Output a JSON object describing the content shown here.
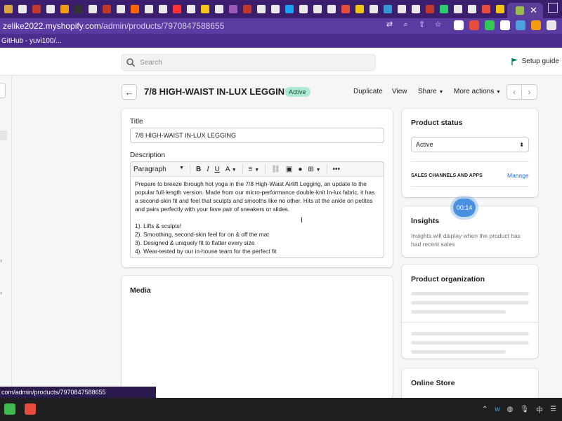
{
  "browser": {
    "tab_favicons": [
      "#d9a441",
      "#e8e8e8",
      "#c0392b",
      "#e8e8e8",
      "#f39c12",
      "#333",
      "#e8e8e8",
      "#c0392b",
      "#e8e8e8",
      "#ff6600",
      "#e8e8e8",
      "#e8e8e8",
      "#ff3333",
      "#e8e8e8",
      "#f5c518",
      "#e8e8e8",
      "#9b59b6",
      "#c0392b",
      "#e8e8e8",
      "#e8e8e8",
      "#1da1f2",
      "#e8e8e8",
      "#e8e8e8",
      "#e8e8e8",
      "#e74c3c",
      "#f1c40f",
      "#e8e8e8",
      "#3498db",
      "#e8e8e8",
      "#e8e8e8",
      "#c0392b",
      "#2ecc71",
      "#e8e8e8",
      "#e8e8e8",
      "#e74c3c",
      "#f1c40f"
    ],
    "url_prefix": "zelike2022.myshopify.com",
    "url_rest": "/admin/products/7970847588655",
    "bookmark_label": "GitHub - yuvi100/...",
    "extension_colors": [
      "#ffffff",
      "#e74c3c",
      "#34c759",
      "#ffffff",
      "#4aa3df",
      "#f39c12",
      "#e8e8e8"
    ]
  },
  "topbar": {
    "search_placeholder": "Search",
    "setup_label": "Setup guide"
  },
  "product": {
    "title": "7/8 HIGH-WAIST IN-LUX LEGGING",
    "status_badge": "Active",
    "actions": {
      "duplicate": "Duplicate",
      "view": "View",
      "share": "Share",
      "more": "More actions"
    }
  },
  "form": {
    "title_label": "Title",
    "title_value": "7/8 HIGH-WAIST IN-LUX LEGGING",
    "description_label": "Description",
    "paragraph_select": "Paragraph",
    "description_paragraph": "Prepare to breeze through hot yoga in the 7/8 High-Waist Airlift Legging, an update to the popular full-length version. Made from our micro-performance double-knit In-lux fabric, it has a second-skin fit and feel that sculpts and smooths like no other. Hits at the ankle on petites and pairs perfectly with your fave pair of sneakers or slides.",
    "description_list": [
      "1). Lifts & sculpts!",
      "2). Smoothing, second-skin feel for on & off the mat",
      "3). Designed & uniquely fit to flatter every size",
      "4). Wear-tested by our in-house team for the perfect fit"
    ],
    "media_label": "Media"
  },
  "side": {
    "status_title": "Product status",
    "status_value": "Active",
    "channels_label": "SALES CHANNELS AND APPS",
    "manage_label": "Manage",
    "timer_label": "00:14",
    "insights_title": "Insights",
    "insights_text": "Insights will display when the product has had recent sales",
    "organization_title": "Product organization",
    "online_store_title": "Online Store"
  },
  "status_bar_url": "com/admin/products/7970847588655",
  "taskbar": {
    "apps": [
      "#3fb950",
      "#e74c3c"
    ],
    "tray_ime": "中"
  }
}
